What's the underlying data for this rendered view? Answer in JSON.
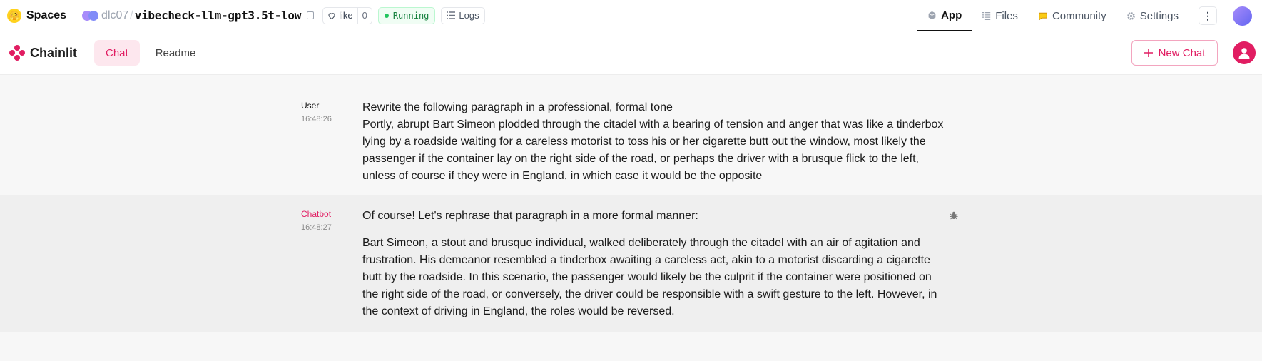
{
  "hf": {
    "brand": "Spaces",
    "owner": "dlc07",
    "slash": "/",
    "repo": "vibecheck-llm-gpt3.5t-low",
    "like_label": "like",
    "like_count": "0",
    "status": "Running",
    "logs_label": "Logs",
    "tabs": [
      {
        "label": "App",
        "icon": "cube-icon"
      },
      {
        "label": "Files",
        "icon": "files-icon"
      },
      {
        "label": "Community",
        "icon": "community-icon"
      },
      {
        "label": "Settings",
        "icon": "gear-icon"
      }
    ],
    "kebab": "⋮"
  },
  "chainlit": {
    "logo_text": "Chainlit",
    "tabs": [
      "Chat",
      "Readme"
    ],
    "new_chat_label": "New Chat",
    "accent": "#e11d62"
  },
  "messages": [
    {
      "author": "User",
      "time": "16:48:26",
      "lines": [
        "Rewrite the following paragraph in a professional, formal tone",
        "Portly, abrupt Bart Simeon plodded through the citadel with a bearing of tension and anger that was like a tinderbox lying by a roadside waiting for a careless motorist to toss his or her cigarette butt out the window, most likely the passenger if the container lay on the right side of the road, or perhaps the driver with a brusque flick to the left, unless of course if they were in England, in which case it would be the opposite"
      ]
    },
    {
      "author": "Chatbot",
      "time": "16:48:27",
      "lines": [
        "Of course! Let's rephrase that paragraph in a more formal manner:",
        "Bart Simeon, a stout and brusque individual, walked deliberately through the citadel with an air of agitation and frustration. His demeanor resembled a tinderbox awaiting a careless act, akin to a motorist discarding a cigarette butt by the roadside. In this scenario, the passenger would likely be the culprit if the container were positioned on the right side of the road, or conversely, the driver could be responsible with a swift gesture to the left. However, in the context of driving in England, the roles would be reversed."
      ]
    }
  ]
}
